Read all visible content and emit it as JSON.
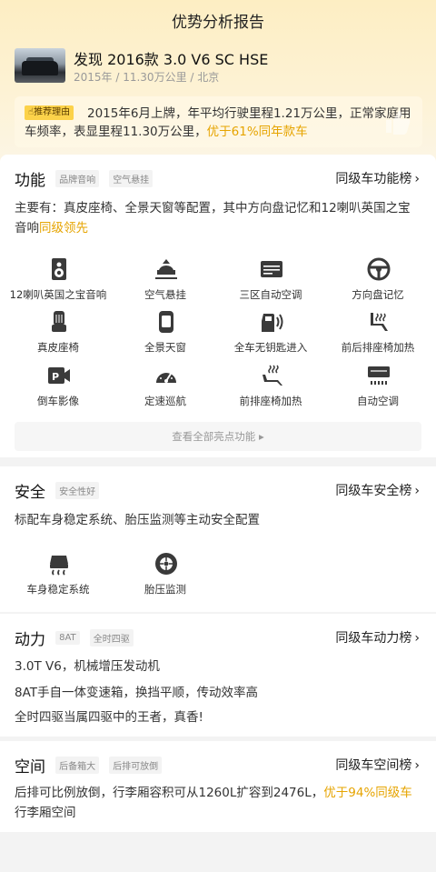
{
  "header": {
    "title": "优势分析报告"
  },
  "car": {
    "name": "发现 2016款 3.0 V6 SC HSE",
    "meta": "2015年 / 11.30万公里 / 北京"
  },
  "reason": {
    "badge": "推荐理由",
    "text_main": "2015年6月上牌，年平均行驶里程1.21万公里，正常家庭用车频率，表显里程11.30万公里，",
    "text_highlight": "优于61%同年款车"
  },
  "function_section": {
    "title": "功能",
    "tags": [
      "品牌音响",
      "空气悬挂"
    ],
    "rank_link": "同级车功能榜",
    "desc_main": "主要有：真皮座椅、全景天窗等配置，其中方向盘记忆和12喇叭英国之宝音响",
    "desc_highlight": "同级领先",
    "features": [
      {
        "label": "12喇叭英国之宝音响",
        "icon": "speaker-icon"
      },
      {
        "label": "空气悬挂",
        "icon": "air-suspension-icon"
      },
      {
        "label": "三区自动空调",
        "icon": "ac-vent-icon"
      },
      {
        "label": "方向盘记忆",
        "icon": "steering-wheel-icon"
      },
      {
        "label": "真皮座椅",
        "icon": "leather-seat-icon"
      },
      {
        "label": "全景天窗",
        "icon": "sunroof-icon"
      },
      {
        "label": "全车无钥匙进入",
        "icon": "keyless-door-icon"
      },
      {
        "label": "前后排座椅加热",
        "icon": "seat-heat-icon"
      },
      {
        "label": "倒车影像",
        "icon": "reverse-camera-icon"
      },
      {
        "label": "定速巡航",
        "icon": "cruise-gauge-icon"
      },
      {
        "label": "前排座椅加热",
        "icon": "front-seat-heat-icon"
      },
      {
        "label": "自动空调",
        "icon": "auto-ac-icon"
      }
    ],
    "more_label": "查看全部亮点功能"
  },
  "safety_section": {
    "title": "安全",
    "tags": [
      "安全性好"
    ],
    "rank_link": "同级车安全榜",
    "desc": "标配车身稳定系统、胎压监测等主动安全配置",
    "features": [
      {
        "label": "车身稳定系统",
        "icon": "stability-control-icon"
      },
      {
        "label": "胎压监测",
        "icon": "tire-pressure-icon"
      }
    ]
  },
  "power_section": {
    "title": "动力",
    "tags": [
      "8AT",
      "全时四驱"
    ],
    "rank_link": "同级车动力榜",
    "lines": [
      "3.0T V6，机械增压发动机",
      "8AT手自一体变速箱，换挡平顺，传动效率高",
      "全时四驱当属四驱中的王者，真香!"
    ]
  },
  "space_section": {
    "title": "空间",
    "tags": [
      "后备箱大",
      "后排可放倒"
    ],
    "rank_link": "同级车空间榜",
    "desc_main": "后排可比例放倒，行李厢容积可从1260L扩容到2476L，",
    "desc_highlight": "优于94%同级车",
    "desc_tail": "行李厢空间"
  },
  "colors": {
    "accent": "#e6a400",
    "badge": "#fcd24a",
    "icon": "#3a3a3a"
  }
}
